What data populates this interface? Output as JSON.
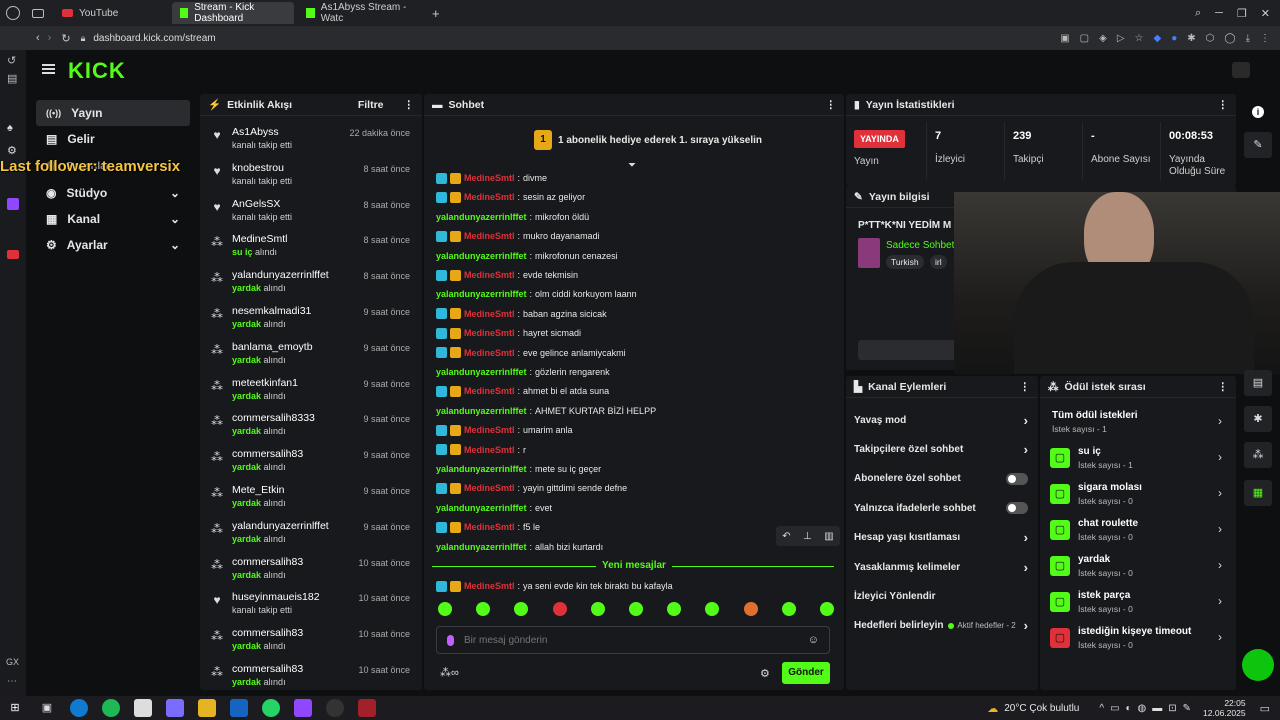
{
  "browser": {
    "tabs": [
      {
        "label": "YouTube"
      },
      {
        "label": "Stream - Kick Dashboard"
      },
      {
        "label": "As1Abyss Stream - Watc"
      }
    ],
    "url": "dashboard.kick.com/stream"
  },
  "overlay": {
    "last_follower": "Last follower: teamversix"
  },
  "app": {
    "logo": "KICK"
  },
  "sidebar": {
    "items": [
      {
        "label": "Yayın"
      },
      {
        "label": "Gelir"
      },
      {
        "label": "Başarılar"
      },
      {
        "label": "Stüdyo"
      },
      {
        "label": "Kanal"
      },
      {
        "label": "Ayarlar"
      }
    ]
  },
  "activity": {
    "title": "Etkinlik Akışı",
    "filter": "Filtre",
    "events": [
      {
        "name": "As1Abyss",
        "time": "22 dakika önce",
        "a": "",
        "b": "kanalı takip etti",
        "icon": "heart"
      },
      {
        "name": "knobestrou",
        "time": "8 saat önce",
        "a": "",
        "b": "kanalı takip etti",
        "icon": "heart"
      },
      {
        "name": "AnGelsSX",
        "time": "8 saat önce",
        "a": "",
        "b": "kanalı takip etti",
        "icon": "heart"
      },
      {
        "name": "MedineSmtl",
        "time": "8 saat önce",
        "a": "su iç",
        "b": "alındı",
        "icon": "reward"
      },
      {
        "name": "yalandunyazerrinlffet",
        "time": "8 saat önce",
        "a": "yardak",
        "b": "alındı",
        "icon": "reward"
      },
      {
        "name": "nesemkalmadi31",
        "time": "9 saat önce",
        "a": "yardak",
        "b": "alındı",
        "icon": "reward"
      },
      {
        "name": "banlama_emoytb",
        "time": "9 saat önce",
        "a": "yardak",
        "b": "alındı",
        "icon": "reward"
      },
      {
        "name": "meteetkinfan1",
        "time": "9 saat önce",
        "a": "yardak",
        "b": "alındı",
        "icon": "reward"
      },
      {
        "name": "commersalih8333",
        "time": "9 saat önce",
        "a": "yardak",
        "b": "alındı",
        "icon": "reward"
      },
      {
        "name": "commersalih83",
        "time": "9 saat önce",
        "a": "yardak",
        "b": "alındı",
        "icon": "reward"
      },
      {
        "name": "Mete_Etkin",
        "time": "9 saat önce",
        "a": "yardak",
        "b": "alındı",
        "icon": "reward"
      },
      {
        "name": "yalandunyazerrinlffet",
        "time": "9 saat önce",
        "a": "yardak",
        "b": "alındı",
        "icon": "reward"
      },
      {
        "name": "commersalih83",
        "time": "10 saat önce",
        "a": "yardak",
        "b": "alındı",
        "icon": "reward"
      },
      {
        "name": "huseyinmaueis182",
        "time": "10 saat önce",
        "a": "",
        "b": "kanalı takip etti",
        "icon": "heart"
      },
      {
        "name": "commersalih83",
        "time": "10 saat önce",
        "a": "yardak",
        "b": "alındı",
        "icon": "reward"
      },
      {
        "name": "commersalih83",
        "time": "10 saat önce",
        "a": "yardak",
        "b": "alındı",
        "icon": "reward"
      }
    ]
  },
  "chat": {
    "title": "Sohbet",
    "banner": "1 abonelik hediye ederek 1. sıraya yükselin",
    "banner_num": "1",
    "messages": [
      {
        "user": "MedineSmtl",
        "text": "divme",
        "type": "sub"
      },
      {
        "user": "MedineSmtl",
        "text": "sesin az geliyor",
        "type": "sub"
      },
      {
        "user": "yalandunyazerrinlffet",
        "text": "mikrofon öldü",
        "type": "plain"
      },
      {
        "user": "MedineSmtl",
        "text": "mukro dayanamadi",
        "type": "sub"
      },
      {
        "user": "yalandunyazerrinlffet",
        "text": "mikrofonun cenazesi",
        "type": "plain"
      },
      {
        "user": "MedineSmtl",
        "text": "evde tekmisin",
        "type": "sub"
      },
      {
        "user": "yalandunyazerrinlffet",
        "text": "olm ciddi korkuyom laann",
        "type": "plain"
      },
      {
        "user": "MedineSmtl",
        "text": "baban agzina sicicak",
        "type": "sub"
      },
      {
        "user": "MedineSmtl",
        "text": "hayret sicmadi",
        "type": "sub"
      },
      {
        "user": "MedineSmtl",
        "text": "eve gelince anlamiycakmi",
        "type": "sub"
      },
      {
        "user": "yalandunyazerrinlffet",
        "text": "gözlerin rengarenk",
        "type": "plain"
      },
      {
        "user": "MedineSmtl",
        "text": "ahmet bi el atda suna",
        "type": "sub"
      },
      {
        "user": "yalandunyazerrinlffet",
        "text": "AHMET KURTAR BİZİ HELPP",
        "type": "plain"
      },
      {
        "user": "MedineSmtl",
        "text": "umarim anla",
        "type": "sub"
      },
      {
        "user": "MedineSmtl",
        "text": "r",
        "type": "sub"
      },
      {
        "user": "yalandunyazerrinlffet",
        "text": "mete su iç geçer",
        "type": "plain"
      },
      {
        "user": "MedineSmtl",
        "text": "yayin gittdimi sende defne",
        "type": "sub"
      },
      {
        "user": "yalandunyazerrinlffet",
        "text": "evet",
        "type": "plain"
      },
      {
        "user": "MedineSmtl",
        "text": "f5 le",
        "type": "sub"
      },
      {
        "user": "yalandunyazerrinlffet",
        "text": "allah bizi kurtardı",
        "type": "plain"
      }
    ],
    "new_messages": "Yeni mesajlar",
    "last_message": {
      "user": "MedineSmtl",
      "text": "ya seni evde kin tek biraktı bu kafayla"
    },
    "input_placeholder": "Bir mesaj gönderin",
    "send": "Gönder"
  },
  "stats": {
    "title": "Yayın İstatistikleri",
    "live": "YAYINDA",
    "live_label": "Yayın",
    "viewers": "7",
    "viewers_label": "İzleyici",
    "followers": "239",
    "followers_label": "Takipçi",
    "subs": "-",
    "subs_label": "Abone Sayısı",
    "duration": "00:08:53",
    "duration_label": "Yayında Olduğu Süre"
  },
  "stream_info": {
    "title": "Yayın bilgisi",
    "stream_title": "P*TT*K*NI YEDİM M",
    "category": "Sadece Sohbet",
    "tags": [
      "Turkish",
      "irl"
    ]
  },
  "channel_actions": {
    "title": "Kanal Eylemleri",
    "items": [
      {
        "label": "Yavaş mod",
        "ctl": "chevron"
      },
      {
        "label": "Takipçilere özel sohbet",
        "ctl": "chevron"
      },
      {
        "label": "Abonelere özel sohbet",
        "ctl": "toggle"
      },
      {
        "label": "Yalnızca ifadelerle sohbet",
        "ctl": "toggle"
      },
      {
        "label": "Hesap yaşı kısıtlaması",
        "ctl": "chevron"
      },
      {
        "label": "Yasaklanmış kelimeler",
        "ctl": "chevron"
      },
      {
        "label": "İzleyici Yönlendir",
        "ctl": "none"
      },
      {
        "label": "Hedefleri belirleyin",
        "ctl": "chevron"
      }
    ],
    "goals_status": "Aktif hedefler - 2"
  },
  "rewards": {
    "title": "Ödül istek sırası",
    "all_label": "Tüm ödül istekleri",
    "all_count": "İstek sayısı - 1",
    "items": [
      {
        "name": "su iç",
        "count": "İstek sayısı - 1",
        "color": "#53fc18"
      },
      {
        "name": "sigara molası",
        "count": "İstek sayısı - 0",
        "color": "#53fc18"
      },
      {
        "name": "chat roulette",
        "count": "İstek sayısı - 0",
        "color": "#53fc18"
      },
      {
        "name": "yardak",
        "count": "İstek sayısı - 0",
        "color": "#53fc18"
      },
      {
        "name": "istek parça",
        "count": "İstek sayısı - 0",
        "color": "#53fc18"
      },
      {
        "name": "istediğin kişeye timeout",
        "count": "İstek sayısı - 0",
        "color": "#e0303a"
      }
    ]
  },
  "taskbar": {
    "weather": "20°C Çok bulutlu",
    "time": "22:05",
    "date": "12.06.2025"
  },
  "colors": {
    "accent": "#53fc18",
    "danger": "#e0303a"
  }
}
